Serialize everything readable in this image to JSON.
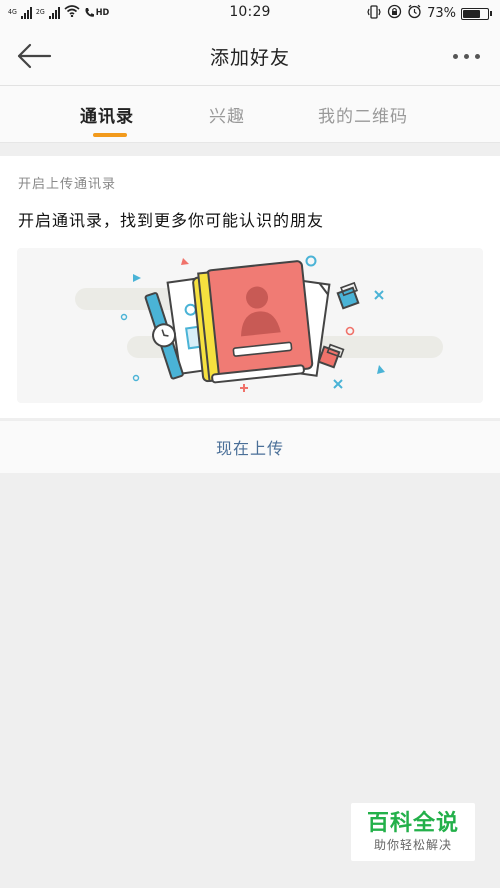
{
  "status_bar": {
    "net1": "4G",
    "net2": "2G",
    "hd": "HD",
    "time": "10:29",
    "battery_percent_text": "73%",
    "battery_level": 0.73
  },
  "header": {
    "title": "添加好友"
  },
  "tabs": [
    {
      "label": "通讯录",
      "active": true
    },
    {
      "label": "兴趣",
      "active": false
    },
    {
      "label": "我的二维码",
      "active": false
    }
  ],
  "colors": {
    "accent": "#f29a1c",
    "link": "#4a6f98",
    "watermark_green": "#23b04a"
  },
  "content": {
    "section_label": "开启上传通讯录",
    "headline": "开启通讯录，找到更多你可能认识的朋友",
    "upload_button": "现在上传"
  },
  "watermark": {
    "title": "百科全说",
    "subtitle": "助你轻松解决"
  }
}
